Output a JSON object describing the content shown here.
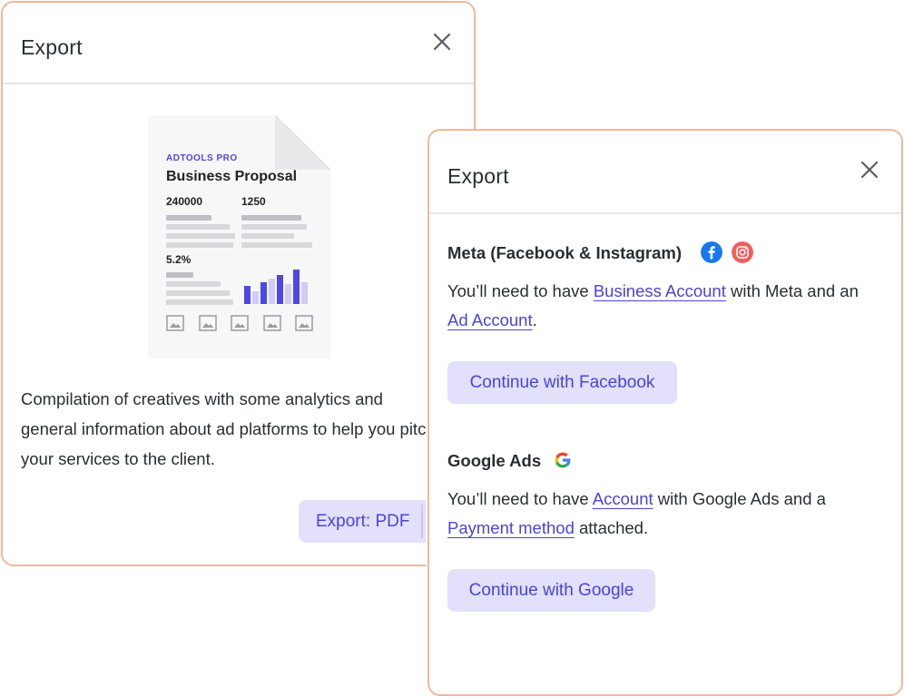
{
  "left_dialog": {
    "title": "Export",
    "close_icon": "close-icon",
    "preview": {
      "brand": "ADTOOLS PRO",
      "title": "Business Proposal",
      "stat1": "240000",
      "stat2": "1250",
      "stat3": "5.2%"
    },
    "description": "Compilation of creatives with some analytics and general information about ad platforms to help you pitch your services to the client.",
    "export_button": "Export: PDF"
  },
  "right_dialog": {
    "title": "Export",
    "close_icon": "close-icon",
    "meta": {
      "title": "Meta (Facebook & Instagram)",
      "text_before": "You’ll need to have ",
      "link1": "Business Account",
      "text_middle": " with Meta and an ",
      "link2": "Ad Account",
      "text_after": ".",
      "button": "Continue with Facebook"
    },
    "google": {
      "title": "Google Ads",
      "text_before": "You’ll need to have ",
      "link1": "Account",
      "text_middle": " with Google Ads and a ",
      "link2": "Payment method",
      "text_after": " attached.",
      "button": "Continue with Google"
    }
  },
  "colors": {
    "accent": "#4a44d8",
    "button_bg": "#e2e0fb",
    "dialog_border": "#f1b89a",
    "facebook": "#1877f2",
    "instagram": "#f25e5e"
  }
}
